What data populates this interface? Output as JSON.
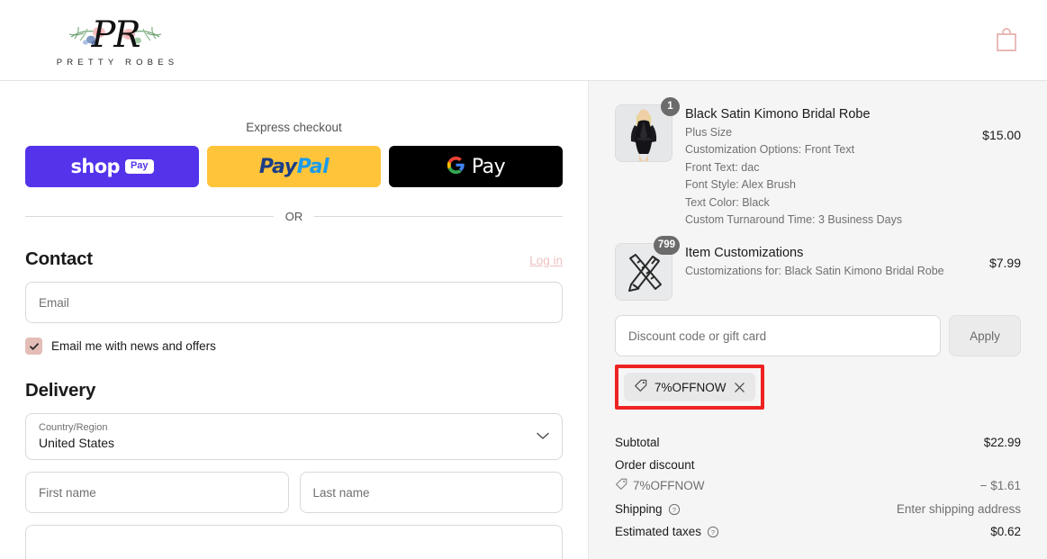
{
  "header": {
    "brand_initials": "PR",
    "brand_wordmark": "PRETTY ROBES",
    "cart_icon": "shopping-bag-icon",
    "accent_pink": "#e8b9b4"
  },
  "express": {
    "label": "Express checkout",
    "or_text": "OR",
    "wallets": [
      {
        "id": "shop-pay",
        "word": "shop",
        "chip": "Pay",
        "bg": "#5433eb"
      },
      {
        "id": "paypal",
        "word_a": "Pay",
        "word_b": "Pal",
        "bg": "#ffc43a"
      },
      {
        "id": "google-pay",
        "word": "Pay",
        "bg": "#000000"
      }
    ]
  },
  "contact": {
    "title": "Contact",
    "login_label": "Log in",
    "email_placeholder": "Email",
    "email_value": "",
    "newsletter_label": "Email me with news and offers",
    "newsletter_checked": true
  },
  "delivery": {
    "title": "Delivery",
    "country_label": "Country/Region",
    "country_value": "United States",
    "first_name_placeholder": "First name",
    "first_name_value": "",
    "last_name_placeholder": "Last name",
    "last_name_value": "",
    "address_placeholder": "",
    "chevron_icon": "chevron-down-icon"
  },
  "summary": {
    "items": [
      {
        "title": "Black Satin Kimono Bridal Robe",
        "qty_badge": "1",
        "price": "$15.00",
        "thumb_icon": "product-photo-robe",
        "options": [
          "Plus Size",
          "Customization Options: Front Text",
          "Front Text: dac",
          "Font Style: Alex Brush",
          "Text Color: Black",
          "Custom Turnaround Time: 3 Business Days"
        ]
      },
      {
        "title": "Item Customizations",
        "qty_badge": "799",
        "price": "$7.99",
        "thumb_icon": "pencil-ruler-icon",
        "options": [
          "Customizations for: Black Satin Kimono Bridal Robe"
        ]
      }
    ],
    "discount": {
      "placeholder": "Discount code or gift card",
      "value": "",
      "apply_label": "Apply",
      "applied_code": "7%OFFNOW",
      "tag_icon": "price-tag-icon",
      "remove_icon": "close-icon",
      "highlight_color": "#ee2222"
    },
    "totals": [
      {
        "label": "Subtotal",
        "value": "$22.99",
        "muted": false,
        "info": false,
        "tag": false
      },
      {
        "label": "Order discount",
        "value": "",
        "muted": false,
        "info": false,
        "tag": false
      },
      {
        "label": "7%OFFNOW",
        "value": "− $1.61",
        "muted": true,
        "info": false,
        "tag": true
      },
      {
        "label": "Shipping",
        "value": "Enter shipping address",
        "muted": false,
        "info": true,
        "tag": false,
        "value_muted": true
      },
      {
        "label": "Estimated taxes",
        "value": "$0.62",
        "muted": false,
        "info": true,
        "tag": false
      }
    ]
  }
}
